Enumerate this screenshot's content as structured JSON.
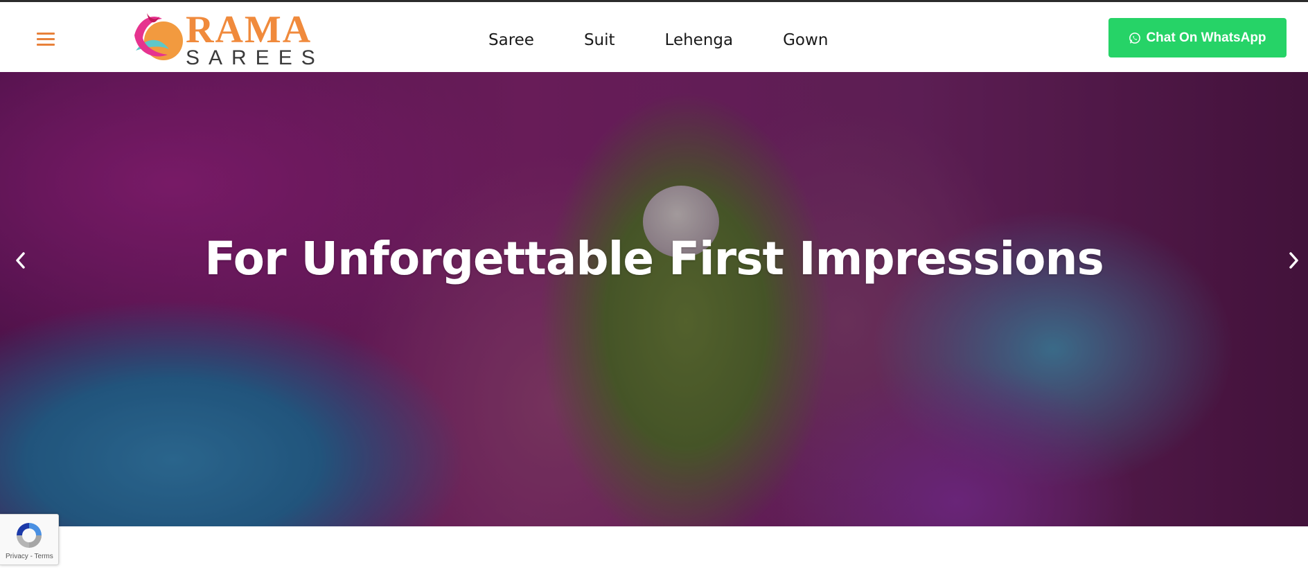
{
  "header": {
    "menu_icon": "hamburger-menu-icon",
    "logo": {
      "word1": "RAMA",
      "word2": "SAREES"
    },
    "nav": [
      {
        "label": "Saree"
      },
      {
        "label": "Suit"
      },
      {
        "label": "Lehenga"
      },
      {
        "label": "Gown"
      }
    ],
    "cta": {
      "label": "Chat On WhatsApp",
      "icon": "whatsapp-icon",
      "color": "#26d367"
    }
  },
  "hero": {
    "title": "For Unforgettable First Impressions",
    "prev_icon": "chevron-left-icon",
    "next_icon": "chevron-right-icon"
  },
  "recaptcha": {
    "privacy": "Privacy",
    "separator": " - ",
    "terms": "Terms"
  },
  "colors": {
    "accent_orange": "#f08a3c",
    "whatsapp_green": "#26d367"
  }
}
